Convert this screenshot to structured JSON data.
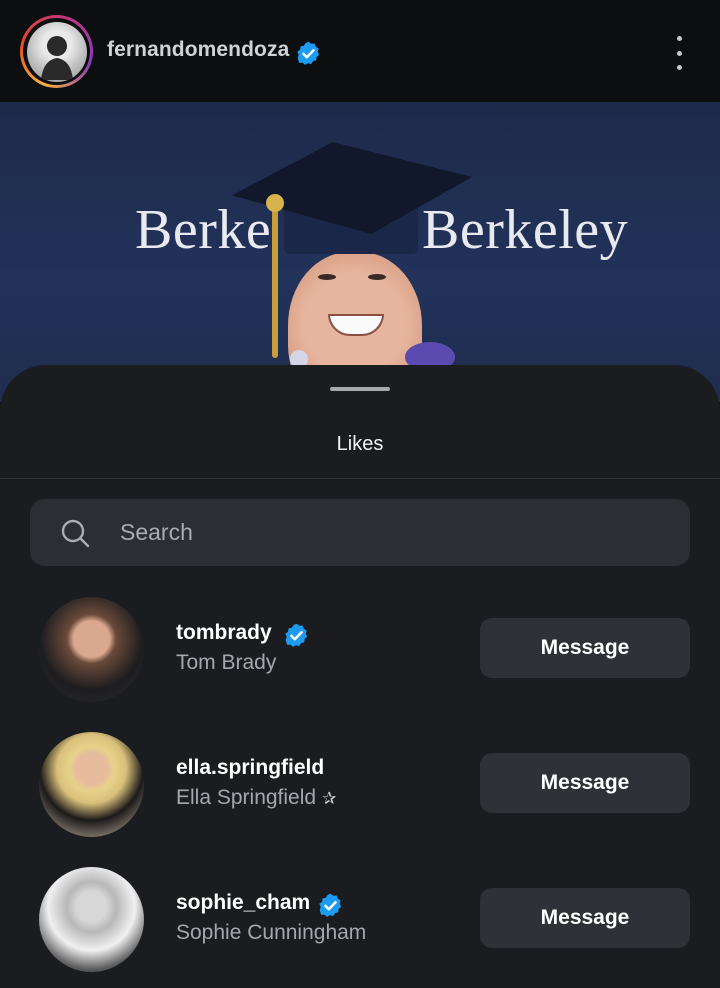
{
  "post": {
    "username": "fernandomendoza",
    "verified": true,
    "backdrop_text": [
      "Berke",
      "Berkeley"
    ]
  },
  "likes_sheet": {
    "title": "Likes",
    "search": {
      "placeholder": "Search",
      "value": ""
    },
    "users": [
      {
        "username": "tombrady",
        "full_name": "Tom Brady",
        "verified": true,
        "button_label": "Message"
      },
      {
        "username": "ella.springfield",
        "full_name": "Ella Springfield",
        "full_name_suffix": "✰",
        "verified": false,
        "button_label": "Message"
      },
      {
        "username": "sophie_cham",
        "full_name": "Sophie Cunningham",
        "verified": true,
        "button_label": "Message"
      }
    ]
  },
  "colors": {
    "verified_blue": "#1d9bf0",
    "sheet_bg": "#1a1c1f",
    "button_bg": "#2e3136"
  },
  "icons": [
    "verified-badge-icon",
    "more-options-icon",
    "search-icon"
  ]
}
